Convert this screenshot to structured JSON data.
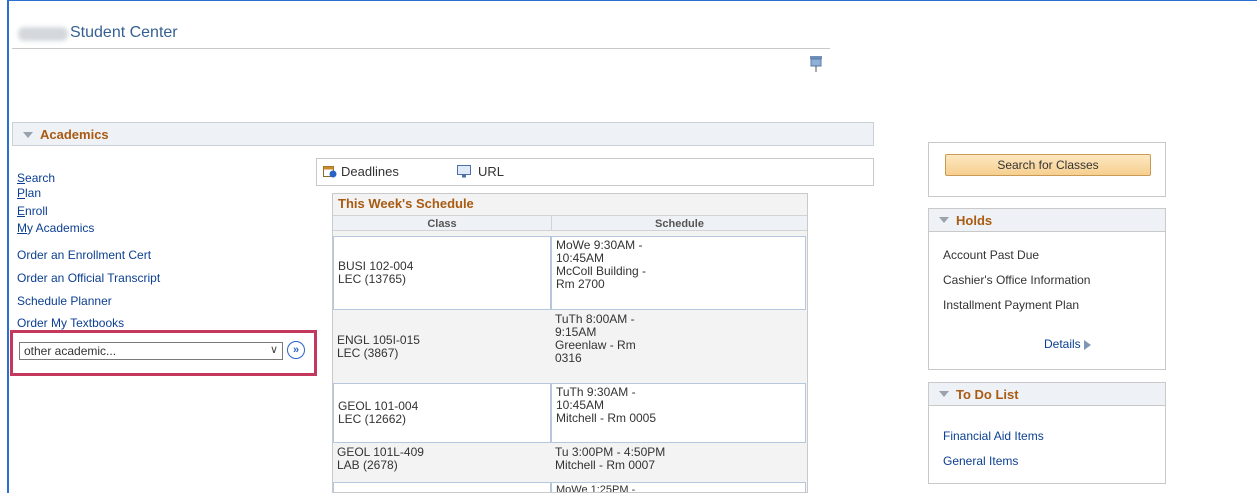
{
  "page": {
    "title": "Student Center"
  },
  "academics": {
    "header": "Academics",
    "nav": {
      "search": "Search",
      "plan": "Plan",
      "enroll": "Enroll",
      "my_academics": "My Academics",
      "order_enrollment_cert": "Order an Enrollment Cert",
      "order_transcript": "Order an Official Transcript",
      "schedule_planner": "Schedule Planner",
      "order_textbooks": "Order My Textbooks"
    },
    "other_select": {
      "value": "other academic..."
    },
    "links": {
      "deadlines": "Deadlines",
      "url": "URL"
    }
  },
  "schedule": {
    "title": "This Week's Schedule",
    "columns": {
      "class": "Class",
      "schedule": "Schedule"
    },
    "rows": [
      {
        "class_line1": "BUSI 102-004",
        "class_line2": "LEC (13765)",
        "sched_lines": [
          "MoWe 9:30AM -",
          "10:45AM",
          "McColl Building -",
          "Rm 2700"
        ]
      },
      {
        "class_line1": "ENGL 105I-015",
        "class_line2": "LEC (3867)",
        "sched_lines": [
          "TuTh 8:00AM -",
          "9:15AM",
          "Greenlaw - Rm",
          "0316"
        ]
      },
      {
        "class_line1": "GEOL 101-004",
        "class_line2": "LEC (12662)",
        "sched_lines": [
          "TuTh 9:30AM -",
          "10:45AM",
          "Mitchell - Rm 0005"
        ]
      },
      {
        "class_line1": "GEOL 101L-409",
        "class_line2": "LAB (2678)",
        "sched_lines": [
          "Tu 3:00PM - 4:50PM",
          "Mitchell - Rm 0007"
        ]
      },
      {
        "class_line1": "",
        "class_line2": "",
        "sched_lines": [
          "MoWe 1:25PM -"
        ]
      }
    ]
  },
  "search_button": "Search for Classes",
  "holds": {
    "title": "Holds",
    "items": [
      "Account Past Due",
      "Cashier's Office Information",
      "Installment Payment Plan"
    ],
    "details": "Details"
  },
  "todo": {
    "title": "To Do List",
    "items": [
      "Financial Aid Items",
      "General Items"
    ]
  },
  "colors": {
    "section_title": "#a95b12",
    "link": "#0b3f91",
    "highlight": "#c4385d"
  }
}
